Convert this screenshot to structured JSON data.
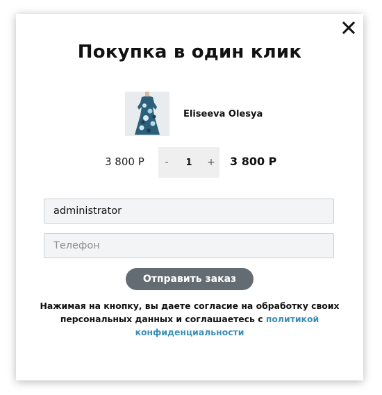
{
  "dialog": {
    "title": "Покупка в один клик",
    "close_icon": "close-icon"
  },
  "product": {
    "image_icon": "dress-thumbnail",
    "name": "Eliseeva Olesya"
  },
  "pricing": {
    "unit_price": "3 800 Р",
    "quantity": "1",
    "decrement_label": "-",
    "increment_label": "+",
    "total_price": "3 800 Р"
  },
  "form": {
    "name_value": "administrator",
    "phone_placeholder": "Телефон",
    "submit_label": "Отправить заказ"
  },
  "consent": {
    "text": "Нажимая на кнопку, вы даете согласие на обработку своих персональных данных и соглашаетесь с ",
    "link_text": "политикой конфиденциальности"
  },
  "colors": {
    "submit_bg": "#646c73",
    "link": "#3a8fb6",
    "stepper_bg": "#efefef",
    "field_bg": "#f3f4f5"
  }
}
